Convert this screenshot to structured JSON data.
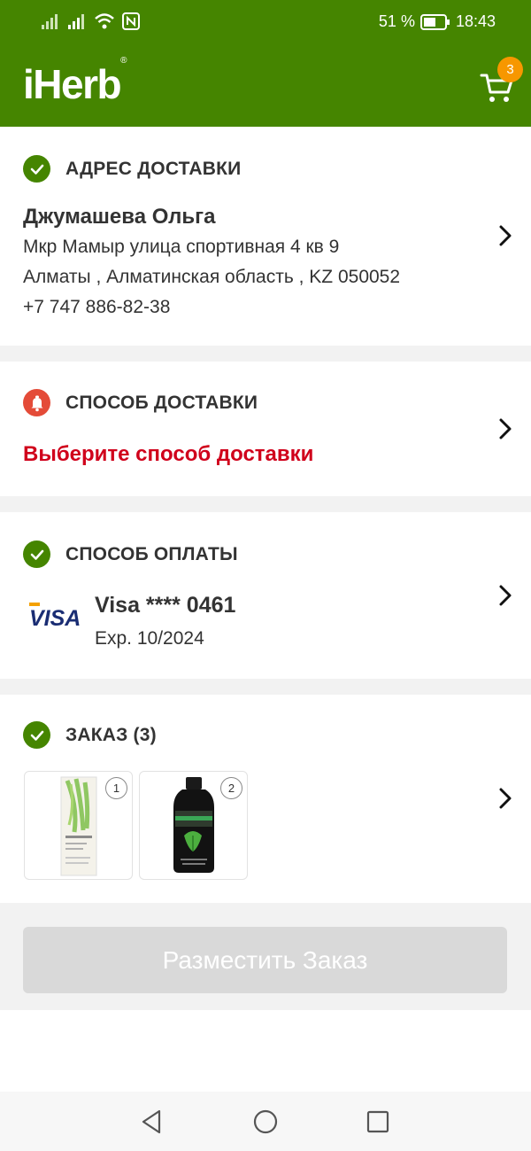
{
  "status_bar": {
    "battery": "51 %",
    "time": "18:43"
  },
  "app": {
    "logo": "iHerb",
    "logo_mark": "®",
    "cart_count": "3",
    "brand_color": "#458500"
  },
  "address": {
    "title": "АДРЕС ДОСТАВКИ",
    "name": "Джумашева Ольга",
    "line1": "Мкр Мамыр улица спортивная 4 кв 9",
    "line2": "Алматы , Алматинская область , KZ 050052",
    "phone": "+7 747 886-82-38"
  },
  "delivery": {
    "title": "СПОСОБ ДОСТАВКИ",
    "prompt": "Выберите способ доставки",
    "warning_color": "#d0011b"
  },
  "payment": {
    "title": "СПОСОБ ОПЛАТЫ",
    "brand": "VISA",
    "card": "Visa **** 0461",
    "expiry": "Exp. 10/2024"
  },
  "order": {
    "title": "ЗАКАЗ (3)",
    "items": [
      {
        "qty": "1",
        "icon": "retinol-serum-bottle"
      },
      {
        "qty": "2",
        "icon": "chlorofresh-bottle"
      }
    ]
  },
  "place_order": {
    "label": "Разместить Заказ"
  }
}
